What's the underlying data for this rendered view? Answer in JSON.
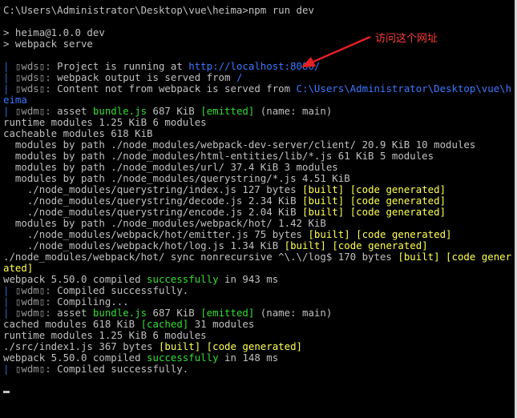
{
  "prompt": "C:\\Users\\Administrator\\Desktop\\vue\\heima>npm run dev",
  "pkg_line": "> heima@1.0.0 dev",
  "serve_line": "> webpack serve",
  "wds1": {
    "prefix": "<i> [webpack-dev-server] ",
    "tag": "▯wds▯: ",
    "text": "Project is running at ",
    "url": "http://localhost:8080/"
  },
  "wds2": {
    "tag": "▯wds▯: ",
    "text": "webpack output is served from ",
    "path": "/"
  },
  "wds3": {
    "tag": "▯wds▯: ",
    "text": "Content not from webpack is served from ",
    "path": "C:\\Users\\Administrator\\Desktop\\vue\\heima"
  },
  "wdm1": {
    "tag": "▯wdm▯: ",
    "text": "asset ",
    "file": "bundle.js",
    "size": " 687 KiB ",
    "flag": "[emitted]",
    "rest": " (name: main)"
  },
  "runtime1": "runtime modules 1.25 KiB 6 modules",
  "cacheable": "cacheable modules 618 KiB",
  "mods": [
    "  modules by path ./node_modules/webpack-dev-server/client/ 20.9 KiB 10 modules",
    "  modules by path ./node_modules/html-entities/lib/*.js 61 KiB 5 modules",
    "  modules by path ./node_modules/url/ 37.4 KiB 3 modules",
    "  modules by path ./node_modules/querystring/*.js 4.51 KiB"
  ],
  "qs": [
    {
      "text": "    ./node_modules/querystring/index.js 127 bytes ",
      "built": "[built]",
      "code": "[code generated]"
    },
    {
      "text": "    ./node_modules/querystring/decode.js 2.34 KiB ",
      "built": "[built]",
      "code": "[code generated]"
    },
    {
      "text": "    ./node_modules/querystring/encode.js 2.04 KiB ",
      "built": "[built]",
      "code": "[code generated]"
    }
  ],
  "hotmods": "  modules by path ./node_modules/webpack/hot/ 1.42 KiB",
  "hot": [
    {
      "text": "    ./node_modules/webpack/hot/emitter.js 75 bytes ",
      "built": "[built]",
      "code": "[code generated]"
    },
    {
      "text": "    ./node_modules/webpack/hot/log.js 1.34 KiB ",
      "built": "[built]",
      "code": "[code generated]"
    }
  ],
  "sync": {
    "text": "./node_modules/webpack/hot/ sync nonrecursive ^\\.\\/log$ 170 bytes ",
    "built": "[built]",
    "code": "[code generated]"
  },
  "compiled1": {
    "pre": "webpack 5.50.0 compiled ",
    "ok": "successfully",
    "post": " in 943 ms"
  },
  "wdm2": {
    "tag": "▯wdm▯: ",
    "text": "Compiled successfully."
  },
  "wdm3": {
    "tag": "▯wdm▯: ",
    "text": "Compiling..."
  },
  "wdm4": {
    "tag": "▯wdm▯: ",
    "text": "asset ",
    "file": "bundle.js",
    "size": " 687 KiB ",
    "flag": "[emitted]",
    "rest": " (name: main)"
  },
  "cached": {
    "pre": "cached modules 618 KiB ",
    "flag": "[cached]",
    "post": " 31 modules"
  },
  "runtime2": "runtime modules 1.25 KiB 6 modules",
  "index1": {
    "text": "./src/index1.js 367 bytes ",
    "built": "[built]",
    "code": "[code generated]"
  },
  "compiled2": {
    "pre": "webpack 5.50.0 compiled ",
    "ok": "successfully",
    "post": " in 148 ms"
  },
  "wdm5": {
    "tag": "▯wdm▯: ",
    "text": "Compiled successfully."
  },
  "annotation": "访问这个网址",
  "colors": {
    "background": "#000000",
    "text": "#c0c0c0",
    "yellow": "#ffff55",
    "green": "#33dd33",
    "link": "#3b78ff",
    "annotation": "#ff3b3b"
  }
}
